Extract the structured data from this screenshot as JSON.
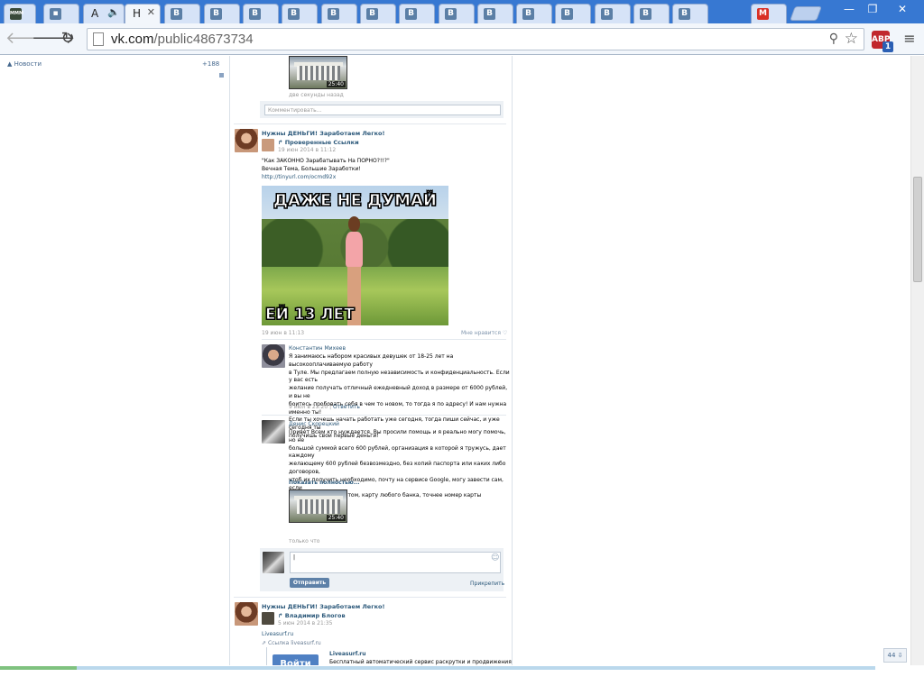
{
  "browser": {
    "tabs": [
      {
        "icon": "МММ",
        "title": "",
        "active": false
      },
      {
        "icon": "▪",
        "title": "",
        "active": false
      },
      {
        "icon": "",
        "title": "А",
        "active": false,
        "audio": "🔈"
      },
      {
        "icon": "",
        "title": "Н",
        "active": true,
        "close": "✕"
      },
      {
        "icon": "B",
        "title": "",
        "active": false
      },
      {
        "icon": "B",
        "title": "",
        "active": false
      },
      {
        "icon": "B",
        "title": "",
        "active": false
      },
      {
        "icon": "B",
        "title": "",
        "active": false
      },
      {
        "icon": "B",
        "title": "",
        "active": false
      },
      {
        "icon": "B",
        "title": "",
        "active": false
      },
      {
        "icon": "B",
        "title": "",
        "active": false
      },
      {
        "icon": "B",
        "title": "",
        "active": false
      },
      {
        "icon": "B",
        "title": "",
        "active": false
      },
      {
        "icon": "B",
        "title": "",
        "active": false
      },
      {
        "icon": "B",
        "title": "",
        "active": false
      },
      {
        "icon": "B",
        "title": "",
        "active": false
      },
      {
        "icon": "B",
        "title": "",
        "active": false
      },
      {
        "icon": "B",
        "title": "",
        "active": false
      },
      {
        "icon": "M",
        "title": "",
        "active": false
      }
    ],
    "window_controls": {
      "minimize": "—",
      "restore": "❐",
      "close": "✕"
    },
    "address": {
      "host": "vk.com",
      "path": "/public48673734"
    },
    "ext_badge": "1",
    "ext_label": "ABP"
  },
  "left_menu": {
    "news_label": "Новости",
    "news_count": "+188"
  },
  "feed": {
    "top_video": {
      "duration": "25:40",
      "time": "две секунды назад"
    },
    "top_comment_placeholder": "Комментировать...",
    "post1": {
      "author": "Нужны ДЕНЬГИ! Заработаем Легко!",
      "repost_from": "Проверенные Ссылки",
      "repost_time": "19 июн 2014 в 11:12",
      "text_lines": [
        "\"Как ЗАКОННО Зарабатывать На ПОРНО?!!?\"",
        "Вечная Тема, Большие Заработки!"
      ],
      "link": "http://tinyurl.com/ocmd92x",
      "meme_top": "ДАЖЕ НЕ ДУМАЙ",
      "meme_bottom": "ЕЙ 13 ЛЕТ",
      "time": "19 июн в 11:13",
      "like_label": "Мне нравится"
    },
    "comment1": {
      "author": "Константин Михеев",
      "text_lines": [
        "Я занимаюсь набором красивых девушек от 18-25 лет на высокооплачиваемую работу",
        "в Туле. Мы предлагаем полную независимость и конфиденциальность. Если у вас есть",
        "желание получать отличный ежедневный доход в размере от 6000 рублей, и вы не",
        "боитесь пробовать себя в чем то новом, то тогда я по адресу! И нам нужна именно ты!",
        "Если ты хочешь начать работать уже сегодня, тогда пиши сейчас, и уже сегодня ты",
        "получишь свои первые деньги!"
      ],
      "time": "9 июл в 23:20",
      "reply": "Ответить"
    },
    "comment2": {
      "author": "Денис Скорецкий",
      "text_lines": [
        "Привет Всем кто нуждается. Вы просили помощь и я реально могу помочь, но не",
        "большой суммой всего 600 рублей, организация в которой я тружусь, дает каждому",
        "желающему 600 рублей безвозмездно, без копий паспорта или каких либо договоров,",
        "чтоб их получить необходимо, почту на сервисе Google, могу завести сам, если",
        "проблемы с интернетом, карту любого банка, точнее номер карты (желательно",
        "Сбербанк т.к."
      ],
      "show_more": "Показать полностью...",
      "video_duration": "25:40",
      "time": "только что"
    },
    "reply_box": {
      "value": "",
      "send": "Отправить",
      "attach": "Прикрепить",
      "emoji": "☺"
    },
    "post2": {
      "author": "Нужны ДЕНЬГИ! Заработаем Легко!",
      "repost_from": "Владимир Блогов",
      "repost_time": "5 июн 2014 в 21:35",
      "link": "Liveasurf.ru",
      "link_caption": "Ссылка liveasurf.ru",
      "card_title": "Liveasurf.ru",
      "card_desc": "Бесплатный автоматический сервис раскрутки и продвижения сайтов",
      "card_button": "Войти"
    }
  },
  "messages_counter": "44 ⇩"
}
